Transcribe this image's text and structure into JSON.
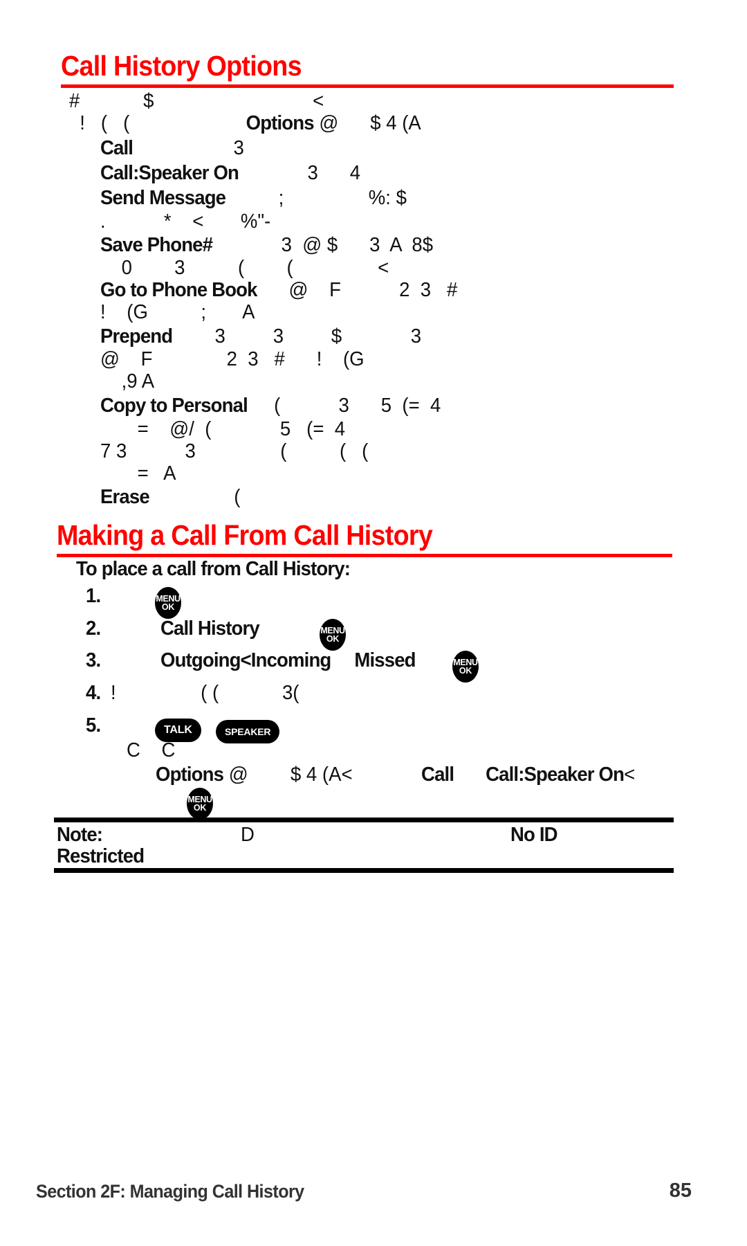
{
  "document": {
    "page_number": "85",
    "footer_section": "Section 2F: Managing Call History",
    "accent_color": "#ff0000",
    "text_color": "#111111"
  },
  "sections": [
    {
      "heading": "Call History Options",
      "lines": [
        {
          "id": "l1",
          "text": "#            $                              <"
        },
        {
          "id": "l2",
          "pre": "  !   (   (                      ",
          "bold": "Options",
          "post": " @      $ 4 (A"
        },
        {
          "id": "l3",
          "bold": "Call",
          "post": "                   3"
        },
        {
          "id": "l4",
          "bold": "Call:Speaker On",
          "post": "             3      4"
        },
        {
          "id": "l5",
          "bold": "Send Message",
          "post": "          ;                %: $"
        },
        {
          "id": "l6",
          "text": ".           *    <       %\"-"
        },
        {
          "id": "l7",
          "bold": "Save Phone#",
          "post": "             3  @ $      3  A  8$"
        },
        {
          "id": "l8",
          "text": "    0        3          (        (                <"
        },
        {
          "id": "l9",
          "bold": "Go to Phone Book",
          "post": "      @    F           2  3   #"
        },
        {
          "id": "l10",
          "text": "!    (G          ;       A"
        },
        {
          "id": "l11",
          "bold": "Prepend",
          "post": "        3         3         $             3"
        },
        {
          "id": "l12",
          "text": "@    F              2  3   #      !    (G"
        },
        {
          "id": "l13",
          "text": "    ,9 A"
        },
        {
          "id": "l14",
          "bold": "Copy to Personal",
          "post": "     (           3      5  (=  4"
        },
        {
          "id": "l15",
          "text": "       =    @/  (             5   (=  4"
        },
        {
          "id": "l16",
          "text": "7 3           3                (          (   ("
        },
        {
          "id": "l17",
          "text": "       =   A"
        },
        {
          "id": "l18",
          "bold": "Erase",
          "post": "                ("
        }
      ]
    },
    {
      "heading": "Making a Call From Call History",
      "intro": "To place a call from Call History:",
      "steps": [
        {
          "number": "1.",
          "icon": "menu-ok-key",
          "icon_label_line1": "MENU",
          "icon_label_line2": "OK"
        },
        {
          "number": "2.",
          "text": "Call History",
          "icon": "menu-ok-key",
          "icon_label_line1": "MENU",
          "icon_label_line2": "OK"
        },
        {
          "number": "3.",
          "text": "Outgoing<Incoming     Missed",
          "icon": "menu-ok-key",
          "icon_label_line1": "MENU",
          "icon_label_line2": "OK"
        },
        {
          "number": "4.",
          "text": "!                ( (            3("
        },
        {
          "number": "5.",
          "key_talk": "TALK",
          "key_speaker": "SPEAKER"
        }
      ],
      "trailing_lines": [
        {
          "id": "t1",
          "text": "   C    C"
        },
        {
          "id": "t2",
          "bold1": "Options",
          "mid1": " @        $ 4 (A<             ",
          "bold2": "Call",
          "mid2": "      ",
          "bold3": "Call:Speaker On",
          "tail": "<"
        }
      ],
      "trailing_icon": {
        "icon": "menu-ok-key",
        "icon_label_line1": "MENU",
        "icon_label_line2": "OK"
      }
    }
  ],
  "note": {
    "label": "Note:",
    "glyph_mid": "D",
    "term1": "No ID",
    "term2": "Restricted"
  }
}
